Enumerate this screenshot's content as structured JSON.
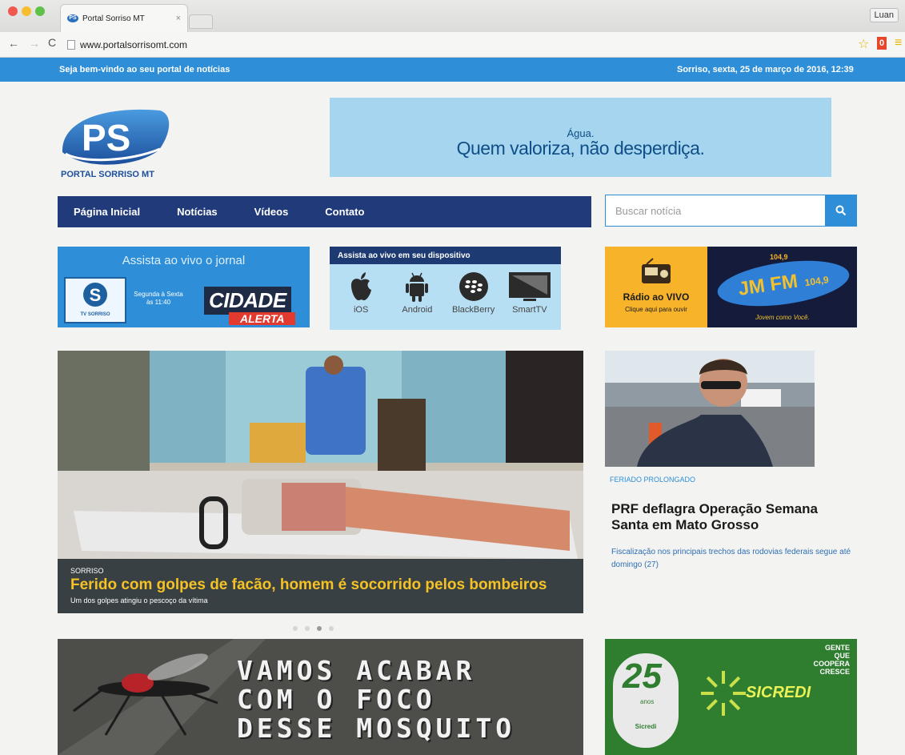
{
  "browser": {
    "tab_title": "Portal Sorriso MT",
    "tab_close": "×",
    "url": "www.portalsorrisomt.com",
    "profile": "Luan"
  },
  "topbar": {
    "welcome": "Seja bem-vindo ao seu portal de notícias",
    "datetime": "Sorriso, sexta, 25 de março de 2016, 12:39"
  },
  "logo": {
    "letters": "PS",
    "name": "PORTAL SORRISO MT"
  },
  "banner_top": {
    "small": "Água.",
    "big": "Quem valoriza, não desperdiça."
  },
  "nav": {
    "items": [
      "Página Inicial",
      "Notícias",
      "Vídeos",
      "Contato"
    ]
  },
  "search": {
    "placeholder": "Buscar notícia"
  },
  "live_tv": {
    "title": "Assista ao vivo o jornal",
    "tv_label": "TV SORRISO",
    "schedule": "Segunda à Sexta às 11:40",
    "show_name": "CIDADE",
    "show_name2": "ALERTA"
  },
  "devices": {
    "heading": "Assista ao vivo em seu dispositivo",
    "items": [
      {
        "label": "iOS",
        "icon": "apple-icon"
      },
      {
        "label": "Android",
        "icon": "android-icon"
      },
      {
        "label": "BlackBerry",
        "icon": "blackberry-icon"
      },
      {
        "label": "SmartTV",
        "icon": "tv-icon"
      }
    ]
  },
  "radio": {
    "title": "Rádio ao VIVO",
    "subtitle": "Clique aqui para ouvir",
    "frequency": "104,9",
    "station": "JM FM",
    "station_freq": "104,9",
    "slogan": "Jovem como Você."
  },
  "hero": {
    "category": "SORRISO",
    "headline": "Ferido com golpes de facão, homem é socorrido pelos bombeiros",
    "subheadline": "Um dos golpes atingiu o pescoço da vítima",
    "slide_count": 4,
    "active_slide": 3
  },
  "side_story": {
    "category": "FERIADO PROLONGADO",
    "title": "PRF deflagra Operação Semana Santa em Mato Grosso",
    "summary": "Fiscalização nos principais trechos das rodovias federais segue até domingo (27)"
  },
  "ads": {
    "dengue_lines": [
      "VAMOS ACABAR",
      "COM O FOCO",
      "DESSE MOSQUITO"
    ],
    "sicredi_slogan_lines": [
      "GENTE",
      "QUE",
      "COOPERA",
      "CRESCE"
    ],
    "sicredi_brand": "SICREDI",
    "sicredi_anniversary": "25",
    "sicredi_anniversary_unit": "anos",
    "sicredi_seal_text": "Sicredi"
  },
  "colors": {
    "site_blue": "#2e8fd8",
    "nav_navy": "#203a7a",
    "headline_yellow": "#f5c225",
    "radio_orange": "#f7b42a",
    "sicredi_green": "#2f7d2e"
  }
}
